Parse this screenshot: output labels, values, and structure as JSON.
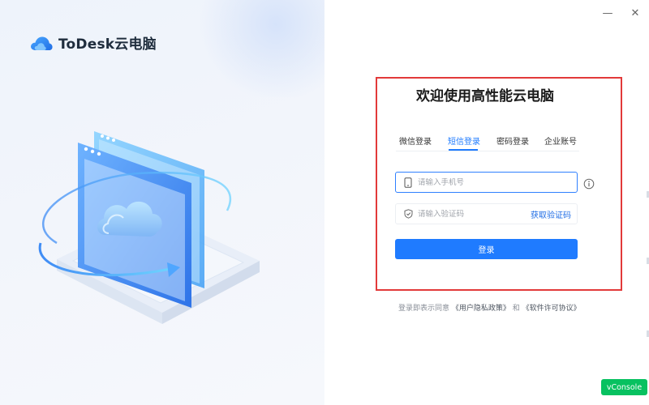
{
  "app": {
    "name": "ToDesk云电脑",
    "logo_icon": "cloud-logo-icon",
    "brand_color": "#1f7bff"
  },
  "window": {
    "minimize_icon": "minimize-icon",
    "close_icon": "close-icon",
    "minimize_glyph": "—",
    "close_glyph": "✕"
  },
  "hero": {
    "illustration": "cloud-browser-illustration"
  },
  "login": {
    "welcome": "欢迎使用高性能云电脑",
    "tabs": [
      {
        "label": "微信登录",
        "active": false
      },
      {
        "label": "短信登录",
        "active": true
      },
      {
        "label": "密码登录",
        "active": false
      },
      {
        "label": "企业账号",
        "active": false
      }
    ],
    "phone_placeholder": "请输入手机号",
    "phone_icon": "phone-icon",
    "info_icon": "info-icon",
    "code_placeholder": "请输入验证码",
    "code_icon": "shield-icon",
    "get_code_label": "获取验证码",
    "submit_label": "登录",
    "highlight_color": "#e23a3a"
  },
  "agreement": {
    "prefix": "登录即表示同意",
    "privacy": "《用户隐私政策》",
    "and": "和",
    "license": "《软件许可协议》"
  },
  "vconsole": {
    "label": "vConsole",
    "color": "#07c160"
  }
}
